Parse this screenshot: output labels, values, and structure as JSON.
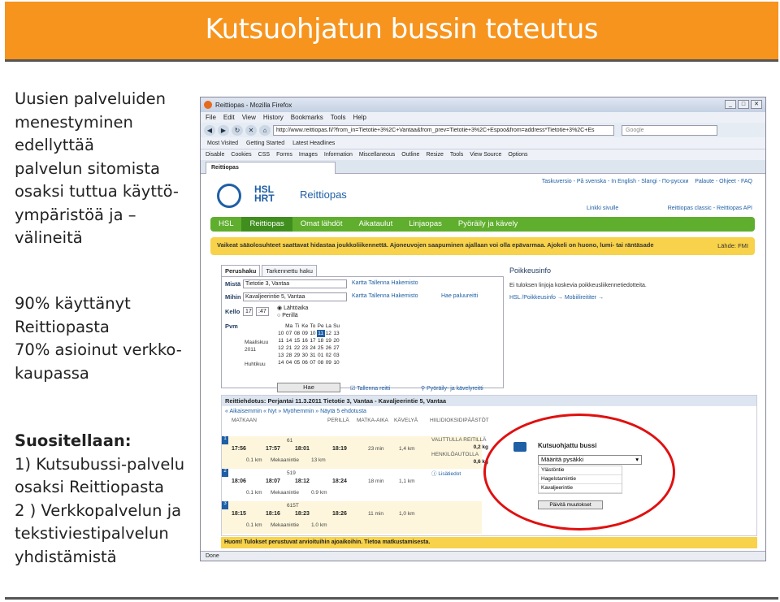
{
  "slide": {
    "title": "Kutsuohjatun bussin toteutus",
    "left_block1": [
      "Uusien palveluiden",
      "menestyminen",
      "edellyttää",
      "palvelun sitomista",
      "osaksi tuttua käyttö-",
      "ympäristöä ja –",
      "välineitä"
    ],
    "left_block2": [
      "90% käyttänyt",
      "Reittiopasta",
      "70% asioinut verkko-",
      "kaupassa"
    ],
    "left_block3_heading": "Suositellaan:",
    "left_block3": [
      "1) Kutsubussi-palvelu",
      "osaksi Reittiopasta",
      "2 ) Verkkopalvelun ja",
      "tekstiviestipalvelun",
      "yhdistämistä"
    ]
  },
  "browser": {
    "window_title": "Reittiopas - Mozilla Firefox",
    "menu": [
      "File",
      "Edit",
      "View",
      "History",
      "Bookmarks",
      "Tools",
      "Help"
    ],
    "url": "http://www.reittiopas.fi/?from_in=Tietotie+3%2C+Vantaa&from_prev=Tietotie+3%2C+Espoo&from=address*Tietotie+3%2C+Es",
    "search_placeholder": "Google",
    "bookmarks": [
      "Most Visited",
      "Getting Started",
      "Latest Headlines"
    ],
    "devbar": [
      "Disable",
      "Cookies",
      "CSS",
      "Forms",
      "Images",
      "Information",
      "Miscellaneous",
      "Outline",
      "Resize",
      "Tools",
      "View Source",
      "Options"
    ],
    "tab_label": "Reittiopas",
    "status": "Done"
  },
  "page": {
    "brand": "Reittiopas",
    "hsl": "HSL",
    "hrt": "HRT",
    "toplinks": "Taskuversio - På svenska - In English - Slangi - По-русски",
    "toplinks_right": "Palaute - Ohjeet - FAQ",
    "linkki": "Linkki sivulle",
    "classic": "Reittiopas classic - Reittiopas API",
    "nav": [
      "HSL",
      "Reittiopas",
      "Omat lähdöt",
      "Aikataulut",
      "Linjaopas",
      "Pyöräily ja kävely"
    ],
    "alert": "Vaikeat sääolosuhteet saattavat hidastaa joukkoliikennettä. Ajoneuvojen saapuminen ajallaan voi olla epävarmaa. Ajokeli on huono, lumi- tai räntäsade",
    "alert_right": "Lähde: FMI",
    "search_tabs": [
      "Perushaku",
      "Tarkennettu haku"
    ],
    "mista": "Mistä",
    "mista_value": "Tietotie 3, Vantaa",
    "mihin": "Mihin",
    "mihin_value": "Kavaljeerintie 5, Vantaa",
    "kello": "Kello",
    "hour": "17",
    "minute": ":47",
    "lahtoaika": "Lähtöaika",
    "perilla": "Perillä",
    "pvm": "Pvm",
    "field_links": "Kartta  Tallenna  Hakemisto",
    "hae_paluureitti": "Hae paluureitti",
    "weekdays": [
      "Ma",
      "Ti",
      "Ke",
      "To",
      "Pe",
      "La",
      "Su"
    ],
    "calendar": [
      [
        "10",
        "07",
        "08",
        "09",
        "10",
        "11",
        "12",
        "13"
      ],
      [
        "11",
        "14",
        "15",
        "16",
        "17",
        "18",
        "19",
        "20"
      ],
      [
        "12",
        "21",
        "22",
        "23",
        "24",
        "25",
        "26",
        "27"
      ],
      [
        "13",
        "28",
        "29",
        "30",
        "31",
        "01",
        "02",
        "03"
      ],
      [
        "14",
        "04",
        "05",
        "06",
        "07",
        "08",
        "09",
        "10"
      ]
    ],
    "months": [
      "Maaliskuu",
      "2011",
      "",
      "Huhtikuu"
    ],
    "hae": "Hae",
    "tallenna_reitti": "Tallenna reitti",
    "pyoraily_link": "Pyöräily- ja kävelyreitti",
    "poikkeus_title": "Poikkeusinfo",
    "poikkeus_text": "Ei tuloksen linjoja koskevia poikkeusliikennetiedotteita.",
    "poikkeus_links": "HSL /Poikkeusinfo →   Mobiilireititer →",
    "results_head": "Reittiehdotus: Perjantai 11.3.2011 Tietotie 3, Vantaa - Kavaljeerintie 5, Vantaa",
    "results_links": "« Aikaisemmin   « Nyt   » Myöhemmin   » Näytä 5 ehdotusta",
    "cols": [
      "MATKAAN",
      "PERILLÄ",
      "MATKA-AIKA",
      "KÄVELYÄ",
      "HIILIDIOKSIDIPÄÄSTÖT"
    ],
    "rows": [
      {
        "num": "1",
        "bus": "61",
        "t1": "17:56",
        "t2": "17:57",
        "t3": "18:01",
        "t4": "18:19",
        "d1": "0.1 km",
        "stop": "Mekaanintie",
        "d2": "13 km",
        "dur": "23 min",
        "walk": "1,4 km"
      },
      {
        "num": "2",
        "bus": "519",
        "t1": "18:06",
        "t2": "18:07",
        "t3": "18:12",
        "t4": "18:24",
        "d1": "0.1 km",
        "stop": "Mekaanintie",
        "d2": "0.9 km",
        "dur": "18 min",
        "walk": "1,1 km"
      },
      {
        "num": "3",
        "bus": "615T",
        "t1": "18:15",
        "t2": "18:16",
        "t3": "18:23",
        "t4": "18:26",
        "d1": "0.1 km",
        "stop": "Mekaanintie",
        "d2": "1.0 km",
        "dur": "11 min",
        "walk": "1,0 km"
      }
    ],
    "co2_valittu": "VALITTULLA REITILLÄ",
    "co2_v_val": "0,2 kg",
    "co2_henk": "HENKILÖAUTOLLA",
    "co2_h_val": "0,6 kg",
    "lisatiedot": "Lisätiedot",
    "footnote": "Huom! Tulokset perustuvat arvioituihin ajoaikoihin. Tietoa matkustamisesta."
  },
  "kutsu": {
    "title": "Kutsuohjattu bussi",
    "select": "Määritä pysäkki",
    "options": [
      "Ylästöntie",
      "Hagelstamintie",
      "Kavaljeerintie"
    ],
    "update": "Päivitä muutokset"
  },
  "colors": {
    "orange": "#f7941d",
    "hsl_blue": "#1f5fa5",
    "green_nav": "#5fae2e",
    "alert_yellow": "#f7d24a",
    "highlight_red": "#e01010"
  }
}
